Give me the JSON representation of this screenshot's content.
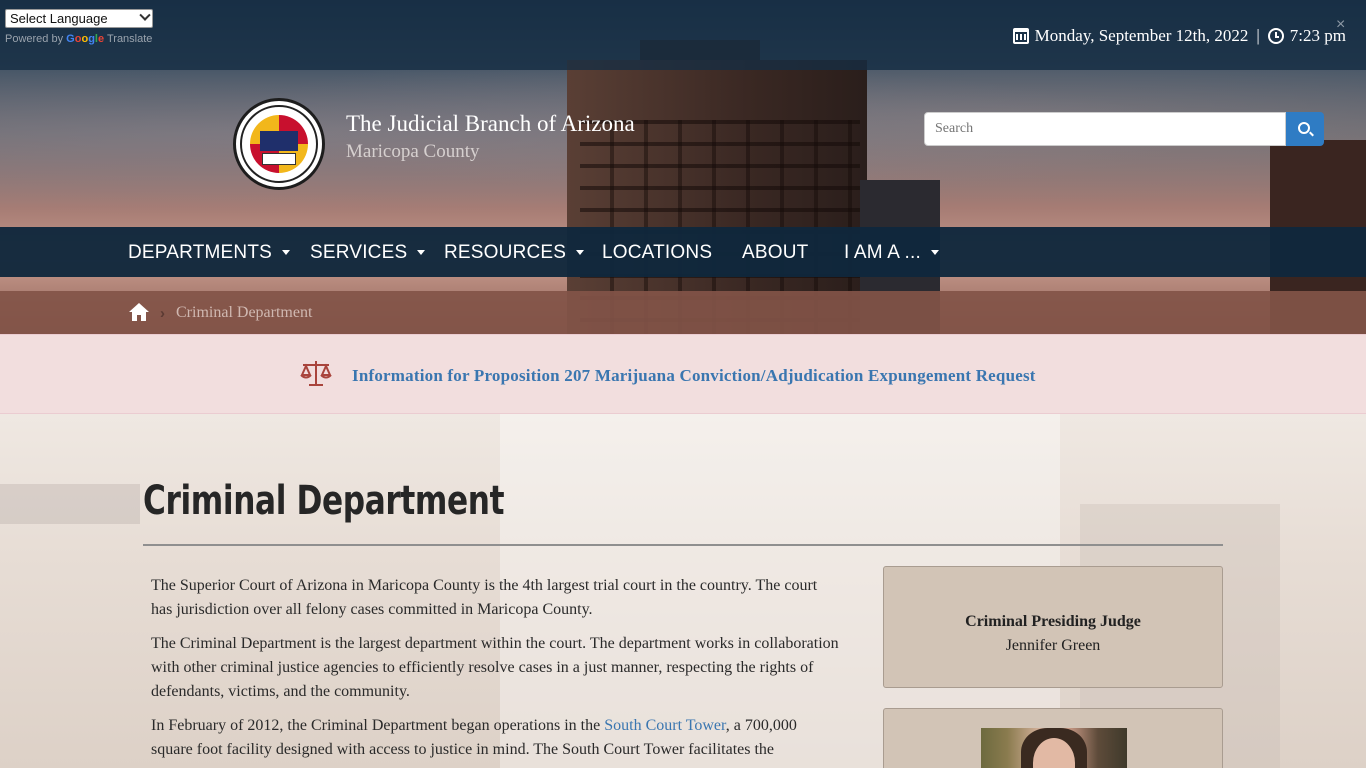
{
  "translate": {
    "select_label": "Select Language",
    "powered_by": "Powered by",
    "google_letters": [
      "G",
      "o",
      "o",
      "g",
      "l",
      "e"
    ],
    "translate_word": "Translate",
    "close": "×"
  },
  "datetime": {
    "date": "Monday, September 12th, 2022",
    "separator": "|",
    "time": "7:23 pm"
  },
  "brand": {
    "title": "The Judicial Branch of Arizona",
    "subtitle": "Maricopa County",
    "seal_alt": "The Judicial Branch of Arizona Maricopa County"
  },
  "search": {
    "placeholder": "Search"
  },
  "nav": {
    "items": [
      {
        "label": "DEPARTMENTS",
        "dropdown": true
      },
      {
        "label": "SERVICES",
        "dropdown": true
      },
      {
        "label": "RESOURCES",
        "dropdown": true
      },
      {
        "label": "LOCATIONS",
        "dropdown": false
      },
      {
        "label": "ABOUT",
        "dropdown": false
      },
      {
        "label": "I AM A ...",
        "dropdown": true
      }
    ]
  },
  "breadcrumb": {
    "current": "Criminal Department"
  },
  "alert": {
    "link_text": "Information for Proposition 207 Marijuana Conviction/Adjudication Expungement Request"
  },
  "main": {
    "title": "Criminal Department",
    "paragraphs": [
      "The Superior Court of Arizona in Maricopa County is the 4th largest trial court in the country.  The court has jurisdiction over all felony cases committed in Maricopa County.",
      "The Criminal Department is the largest department within the court.  The department works in collaboration with other criminal justice agencies to efficiently resolve cases in a just manner, respecting the rights of defendants, victims, and the community."
    ],
    "p3_before": "In February of 2012, the Criminal Department began operations in the ",
    "p3_link": "South Court Tower",
    "p3_after": ", a 700,000 square foot facility designed with access to justice in mind.  The South Court Tower facilitates the"
  },
  "sidebar": {
    "judge_title": "Criminal Presiding Judge",
    "judge_name": "Jennifer Green"
  },
  "colors": {
    "nav_bg": "#10283c",
    "breadcrumb_bg": "#825448",
    "alert_bg": "#f2dede",
    "link": "#3a76b0",
    "search_button": "#2f7cc4",
    "card_bg": "#d2c4b6"
  },
  "icons": [
    "calendar-icon",
    "clock-icon",
    "search-icon",
    "home-icon",
    "chevron-right-icon",
    "scales-icon",
    "caret-down-icon"
  ]
}
